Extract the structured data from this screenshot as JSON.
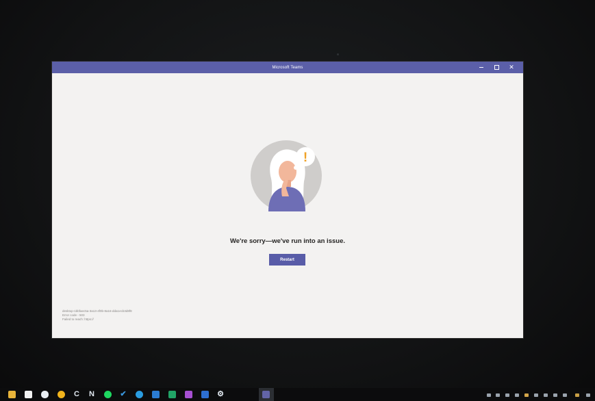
{
  "window": {
    "title": "Microsoft Teams"
  },
  "error": {
    "heading": "We're sorry—we've run into an issue.",
    "restart_label": "Restart",
    "exclamation": "!"
  },
  "diagnostics": {
    "line1": "desktop-1bbfaec5a-3a13-4f0b-8a16-dda1ecb3d8f8",
    "line2": "Error code - 503",
    "line3": "Failed to reach: https://"
  },
  "taskbar": {
    "apps": [
      {
        "name": "file-explorer-icon",
        "color": "#e8b43a"
      },
      {
        "name": "store-icon",
        "color": "#f2f2f2"
      },
      {
        "name": "mail-icon",
        "color": "#e9eef3"
      },
      {
        "name": "chrome-icon",
        "color": "#f1b31c"
      },
      {
        "name": "c-app-icon",
        "glyph": "C"
      },
      {
        "name": "notion-icon",
        "glyph": "N"
      },
      {
        "name": "spotify-icon",
        "color": "#1ed760"
      },
      {
        "name": "todo-icon",
        "glyph": "✔",
        "color": "#3a96dd"
      },
      {
        "name": "edge-icon",
        "color": "#2a9ce0"
      },
      {
        "name": "word-icon",
        "color": "#2b7cd3"
      },
      {
        "name": "excel-icon",
        "color": "#21a366"
      },
      {
        "name": "onenote-icon",
        "color": "#a64fd1"
      },
      {
        "name": "outlook-icon",
        "color": "#2d6ed1"
      },
      {
        "name": "settings-icon",
        "glyph": "⚙"
      },
      {
        "name": "teams-icon",
        "color": "#6264a7"
      }
    ]
  },
  "colors": {
    "titlebar": "#5b5fa8",
    "accent": "#585ca8",
    "window_bg": "#f3f2f1"
  }
}
